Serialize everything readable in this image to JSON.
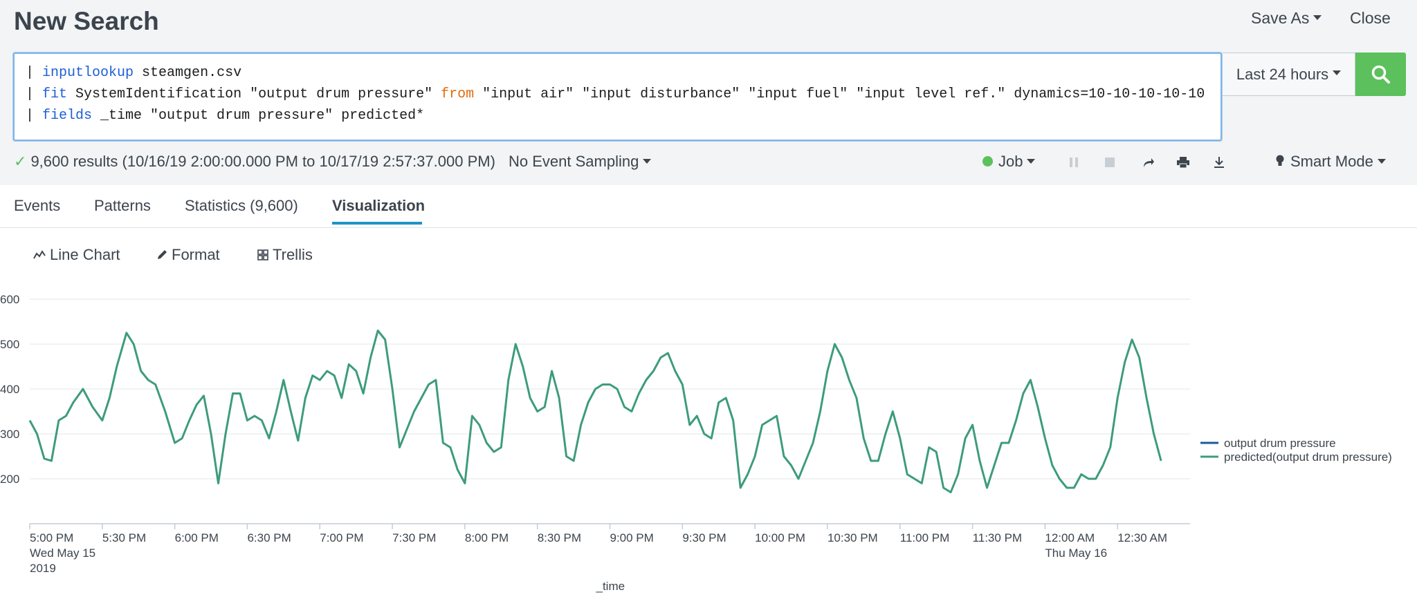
{
  "header": {
    "title": "New Search",
    "save_as": "Save As",
    "close": "Close"
  },
  "search": {
    "line1_pipe": "| ",
    "line1_cmd": "inputlookup",
    "line1_rest": " steamgen.csv",
    "line2_pipe": "| ",
    "line2_cmd": "fit",
    "line2_mid": " SystemIdentification \"output drum pressure\" ",
    "line2_from": "from",
    "line2_rest": " \"input air\" \"input disturbance\" \"input fuel\" \"input level ref.\" dynamics=10-10-10-10-10",
    "line3_pipe": "| ",
    "line3_cmd": "fields",
    "line3_rest": " _time \"output drum pressure\" predicted*",
    "time_range": "Last 24 hours"
  },
  "status": {
    "check": "✓",
    "results": "9,600 results (10/16/19 2:00:00.000 PM to 10/17/19 2:57:37.000 PM)",
    "sampling": "No Event Sampling",
    "job": "Job",
    "mode": "Smart Mode"
  },
  "tabs": [
    {
      "label": "Events"
    },
    {
      "label": "Patterns"
    },
    {
      "label": "Statistics (9,600)"
    },
    {
      "label": "Visualization"
    }
  ],
  "viz_toolbar": {
    "chart_type": "Line Chart",
    "format": "Format",
    "trellis": "Trellis"
  },
  "colors": {
    "series_output": "#1a5a9e",
    "series_predicted": "#3d9c7a",
    "accent_green": "#5cc05c",
    "tab_underline": "#1e93c6"
  },
  "chart_data": {
    "type": "line",
    "x_tick_labels": [
      "5:00 PM",
      "5:30 PM",
      "6:00 PM",
      "6:30 PM",
      "7:00 PM",
      "7:30 PM",
      "8:00 PM",
      "8:30 PM",
      "9:00 PM",
      "9:30 PM",
      "10:00 PM",
      "10:30 PM",
      "11:00 PM",
      "11:30 PM",
      "12:00 AM",
      "12:30 AM"
    ],
    "x_sub_labels": {
      "start": [
        "Wed May 15",
        "2019"
      ],
      "midnight": [
        "Thu May 16"
      ]
    },
    "xlabel": "_time",
    "ylabel": "",
    "y_ticks": [
      200,
      300,
      400,
      500,
      600
    ],
    "ylim": [
      100,
      600
    ],
    "x_range_minutes": [
      0,
      480
    ],
    "legend": {
      "position": "right",
      "entries": [
        "output drum pressure",
        "predicted(output drum pressure)"
      ]
    },
    "series": [
      {
        "name": "predicted(output drum pressure)",
        "x_minutes": [
          0,
          3,
          6,
          9,
          12,
          15,
          18,
          22,
          26,
          30,
          33,
          36,
          40,
          43,
          46,
          49,
          52,
          56,
          60,
          63,
          66,
          69,
          72,
          75,
          78,
          81,
          84,
          87,
          90,
          93,
          96,
          99,
          102,
          105,
          108,
          111,
          114,
          117,
          120,
          123,
          126,
          129,
          132,
          135,
          138,
          141,
          144,
          147,
          150,
          153,
          156,
          159,
          162,
          165,
          168,
          171,
          174,
          177,
          180,
          183,
          186,
          189,
          192,
          195,
          198,
          201,
          204,
          207,
          210,
          213,
          216,
          219,
          222,
          225,
          228,
          231,
          234,
          237,
          240,
          243,
          246,
          249,
          252,
          255,
          258,
          261,
          264,
          267,
          270,
          273,
          276,
          279,
          282,
          285,
          288,
          291,
          294,
          297,
          300,
          303,
          306,
          309,
          312,
          315,
          318,
          321,
          324,
          327,
          330,
          333,
          336,
          339,
          342,
          345,
          348,
          351,
          354,
          357,
          360,
          363,
          366,
          369,
          372,
          375,
          378,
          381,
          384,
          387,
          390,
          393,
          396,
          399,
          402,
          405,
          408,
          411,
          414,
          417,
          420,
          423,
          426,
          429,
          432,
          435,
          438,
          441,
          444,
          447,
          450,
          453,
          456,
          459,
          462,
          465,
          468,
          471,
          474,
          477,
          480
        ],
        "values": [
          330,
          300,
          245,
          240,
          330,
          340,
          370,
          400,
          360,
          330,
          380,
          450,
          525,
          500,
          440,
          420,
          410,
          350,
          280,
          290,
          330,
          365,
          385,
          300,
          190,
          300,
          390,
          390,
          330,
          340,
          330,
          290,
          350,
          420,
          350,
          285,
          380,
          430,
          420,
          440,
          430,
          380,
          455,
          440,
          390,
          470,
          530,
          510,
          400,
          270,
          310,
          350,
          380,
          410,
          420,
          280,
          270,
          220,
          190,
          340,
          320,
          280,
          260,
          270,
          420,
          500,
          450,
          380,
          350,
          360,
          440,
          380,
          250,
          240,
          320,
          370,
          400,
          410,
          410,
          400,
          360,
          350,
          390,
          420,
          440,
          470,
          480,
          440,
          410,
          320,
          340,
          300,
          290,
          370,
          380,
          330,
          180,
          210,
          250,
          320,
          330,
          340,
          250,
          230,
          200,
          240,
          280,
          350,
          440,
          500,
          470,
          420,
          380,
          290,
          240,
          240,
          300,
          350,
          290,
          210,
          200,
          190,
          270,
          260,
          180,
          170,
          210,
          290,
          320,
          240,
          180,
          230,
          280,
          280,
          330,
          390,
          420,
          360,
          290,
          230,
          200,
          180,
          180,
          210,
          200,
          200,
          230,
          270,
          380,
          460,
          510,
          470,
          380,
          300,
          240
        ]
      }
    ]
  }
}
